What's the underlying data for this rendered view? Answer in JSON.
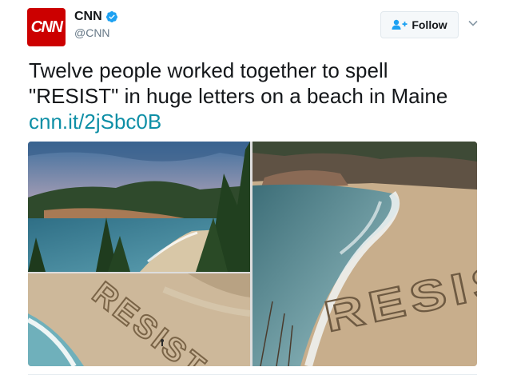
{
  "account": {
    "display_name": "CNN",
    "handle": "@CNN",
    "avatar_text": "CNN",
    "verified": true
  },
  "follow_button": {
    "label": "Follow"
  },
  "tweet": {
    "text_line1": "Twelve people worked together to spell",
    "text_line2": "\"RESIST\" in huge letters on a beach in Maine",
    "link": "cnn.it/2jSbc0B"
  },
  "media": {
    "photo_beach_word": "RESIST"
  },
  "colors": {
    "brand_red": "#cc0000",
    "link": "#0e8fa6",
    "verified_blue": "#1da1f2"
  },
  "icons": [
    "verified-badge-icon",
    "follow-user-plus-icon",
    "chevron-down-icon"
  ]
}
